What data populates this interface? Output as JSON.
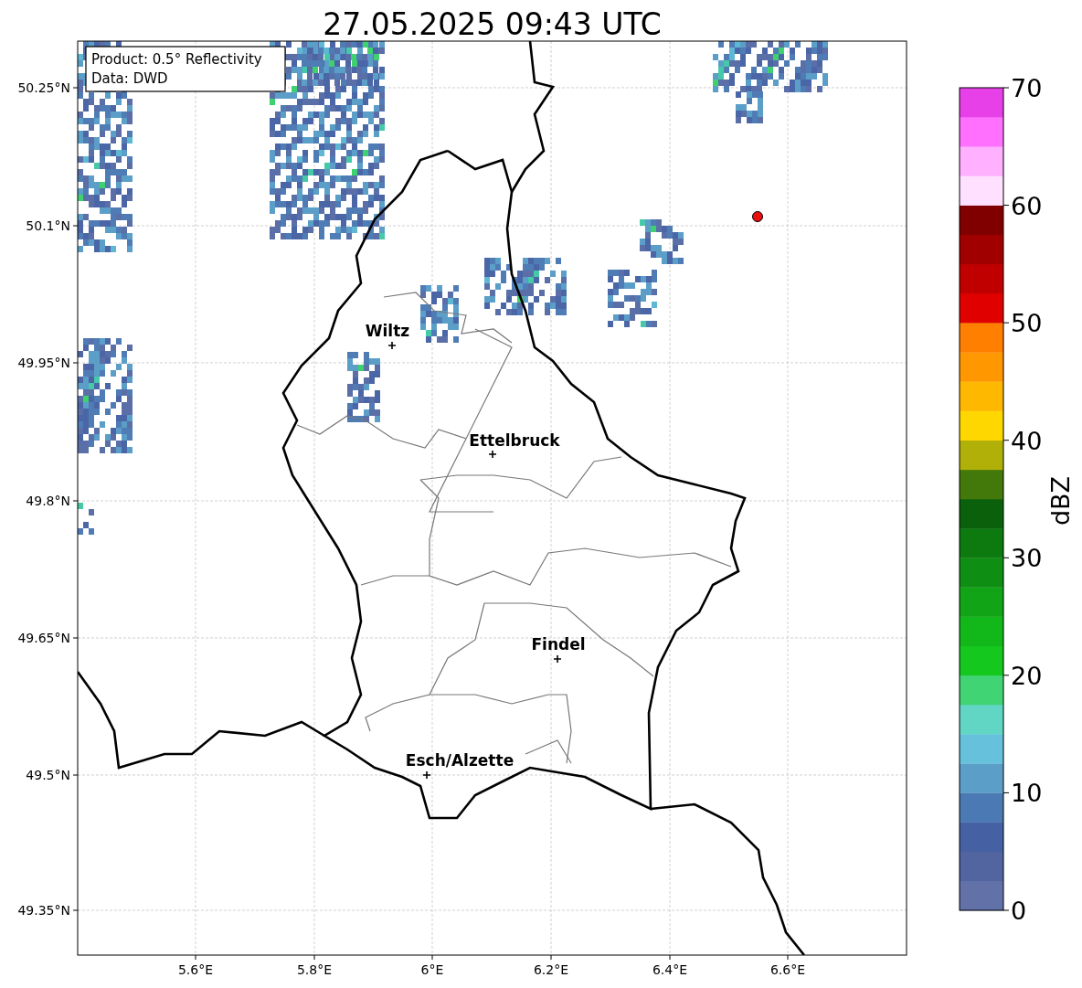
{
  "title": "27.05.2025 09:43 UTC",
  "info_box": [
    "Product: 0.5° Reflectivity",
    "Data: DWD"
  ],
  "map": {
    "lat_ticks": [
      "50.25°N",
      "50.1°N",
      "49.95°N",
      "49.8°N",
      "49.65°N",
      "49.5°N",
      "49.35°N"
    ],
    "lon_ticks": [
      "5.6°E",
      "5.8°E",
      "6°E",
      "6.2°E",
      "6.4°E",
      "6.6°E"
    ],
    "cities": [
      {
        "name": "Wiltz"
      },
      {
        "name": "Ettelbruck"
      },
      {
        "name": "Findel"
      },
      {
        "name": "Esch/Alzette"
      }
    ]
  },
  "colorbar": {
    "label": "dBZ",
    "ticks": [
      "70",
      "60",
      "50",
      "40",
      "30",
      "20",
      "10",
      "0"
    ],
    "bins": [
      {
        "color": "#6272a8"
      },
      {
        "color": "#5265a0"
      },
      {
        "color": "#4560a3"
      },
      {
        "color": "#4a79b3"
      },
      {
        "color": "#5b9ec8"
      },
      {
        "color": "#66c2dc"
      },
      {
        "color": "#62d6c4"
      },
      {
        "color": "#40d474"
      },
      {
        "color": "#14c81e"
      },
      {
        "color": "#12b81a"
      },
      {
        "color": "#10a416"
      },
      {
        "color": "#0f8e14"
      },
      {
        "color": "#0d7a10"
      },
      {
        "color": "#0b600c"
      },
      {
        "color": "#43780a"
      },
      {
        "color": "#b0b008"
      },
      {
        "color": "#ffd700"
      },
      {
        "color": "#ffb800"
      },
      {
        "color": "#ff9800"
      },
      {
        "color": "#ff7f00"
      },
      {
        "color": "#e00000"
      },
      {
        "color": "#c00000"
      },
      {
        "color": "#a00000"
      },
      {
        "color": "#800000"
      },
      {
        "color": "#ffe0ff"
      },
      {
        "color": "#ffb0ff"
      },
      {
        "color": "#ff70ff"
      },
      {
        "color": "#e840e8"
      }
    ]
  }
}
